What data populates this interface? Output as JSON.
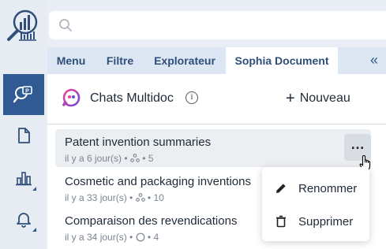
{
  "search": {
    "placeholder": ""
  },
  "tabs": [
    {
      "label": "Menu"
    },
    {
      "label": "Filtre"
    },
    {
      "label": "Explorateur"
    },
    {
      "label": "Sophia Document"
    }
  ],
  "collapse_label": "«",
  "panel": {
    "title": "Chats Multidoc",
    "info_glyph": "i",
    "new_label": "Nouveau"
  },
  "chats": [
    {
      "title": "Patent invention summaries",
      "meta": "il y a 6 jour(s) • ",
      "count": "5",
      "icon": "nodes-icon"
    },
    {
      "title": "Cosmetic and packaging inventions",
      "meta": "il y a 33 jour(s) • ",
      "count": "10",
      "icon": "nodes-icon"
    },
    {
      "title": "Comparaison des revendications",
      "meta": "il y a 34 jour(s) • ",
      "count": "4",
      "icon": "circle-icon"
    }
  ],
  "more_glyph": "…",
  "context_menu": {
    "rename_label": "Renommer",
    "delete_label": "Supprimer"
  },
  "colors": {
    "accent": "#2f5a92",
    "tab_bg": "#dde7f3",
    "rail_bg": "#e6ecf2"
  }
}
